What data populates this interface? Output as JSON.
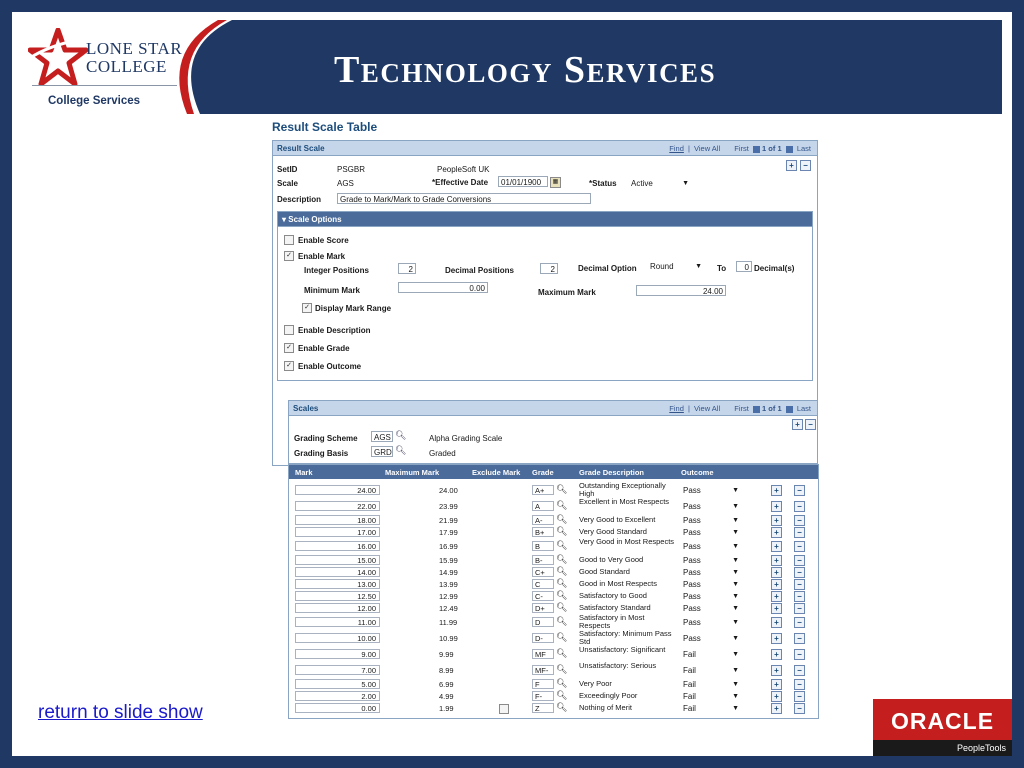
{
  "header": {
    "logo_line1": "Lone Star",
    "logo_line2": "College",
    "logo_services": "College Services",
    "title": "Technology Services",
    "brand_navy": "#1f3864",
    "brand_red": "#c41e1e"
  },
  "page_title": "Result Scale Table",
  "result_scale": {
    "bar_title": "Result Scale",
    "nav": {
      "find": "Find",
      "view_all": "View All",
      "first": "First",
      "count": "1 of 1",
      "last": "Last"
    },
    "setid_label": "SetID",
    "setid_value": "PSGBR",
    "setid_desc": "PeopleSoft UK",
    "scale_label": "Scale",
    "scale_value": "AGS",
    "eff_date_label": "*Effective Date",
    "eff_date_value": "01/01/1900",
    "status_label": "*Status",
    "status_value": "Active",
    "description_label": "Description",
    "description_value": "Grade to Mark/Mark to Grade Conversions"
  },
  "scale_options": {
    "bar_title": "Scale Options",
    "enable_score": "Enable Score",
    "enable_mark": "Enable Mark",
    "integer_positions_label": "Integer Positions",
    "integer_positions_value": "2",
    "decimal_positions_label": "Decimal Positions",
    "decimal_positions_value": "2",
    "decimal_option_label": "Decimal Option",
    "decimal_option_value": "Round",
    "to_label": "To",
    "to_value": "0",
    "decimals_label": "Decimal(s)",
    "minimum_mark_label": "Minimum Mark",
    "minimum_mark_value": "0.00",
    "maximum_mark_label": "Maximum Mark",
    "maximum_mark_value": "24.00",
    "display_mark_range": "Display Mark Range",
    "enable_description": "Enable Description",
    "enable_grade": "Enable Grade",
    "enable_outcome": "Enable Outcome"
  },
  "scales": {
    "bar_title": "Scales",
    "nav": {
      "find": "Find",
      "view_all": "View All",
      "first": "First",
      "count": "1 of 1",
      "last": "Last"
    },
    "grading_scheme_label": "Grading Scheme",
    "grading_scheme_value": "AGS",
    "grading_scheme_desc": "Alpha Grading Scale",
    "grading_basis_label": "Grading Basis",
    "grading_basis_value": "GRD",
    "grading_basis_desc": "Graded"
  },
  "grid": {
    "columns": [
      "Mark",
      "Maximum Mark",
      "Exclude Mark",
      "Grade",
      "Grade Description",
      "Outcome"
    ],
    "rows": [
      {
        "mark": "24.00",
        "max": "24.00",
        "grade": "A+",
        "desc": "Outstanding Exceptionally High",
        "outcome": "Pass"
      },
      {
        "mark": "22.00",
        "max": "23.99",
        "grade": "A",
        "desc": "Excellent in Most Respects",
        "outcome": "Pass"
      },
      {
        "mark": "18.00",
        "max": "21.99",
        "grade": "A-",
        "desc": "Very Good to Excellent",
        "outcome": "Pass"
      },
      {
        "mark": "17.00",
        "max": "17.99",
        "grade": "B+",
        "desc": "Very Good Standard",
        "outcome": "Pass"
      },
      {
        "mark": "16.00",
        "max": "16.99",
        "grade": "B",
        "desc": "Very Good in Most Respects",
        "outcome": "Pass"
      },
      {
        "mark": "15.00",
        "max": "15.99",
        "grade": "B-",
        "desc": "Good to Very Good",
        "outcome": "Pass"
      },
      {
        "mark": "14.00",
        "max": "14.99",
        "grade": "C+",
        "desc": "Good Standard",
        "outcome": "Pass"
      },
      {
        "mark": "13.00",
        "max": "13.99",
        "grade": "C",
        "desc": "Good in Most Respects",
        "outcome": "Pass"
      },
      {
        "mark": "12.50",
        "max": "12.99",
        "grade": "C-",
        "desc": "Satisfactory to Good",
        "outcome": "Pass"
      },
      {
        "mark": "12.00",
        "max": "12.49",
        "grade": "D+",
        "desc": "Satisfactory Standard",
        "outcome": "Pass"
      },
      {
        "mark": "11.00",
        "max": "11.99",
        "grade": "D",
        "desc": "Satisfactory in Most Respects",
        "outcome": "Pass"
      },
      {
        "mark": "10.00",
        "max": "10.99",
        "grade": "D-",
        "desc": "Satisfactory: Minimum Pass Std",
        "outcome": "Pass"
      },
      {
        "mark": "9.00",
        "max": "9.99",
        "grade": "MF",
        "desc": "Unsatisfactory: Significant",
        "outcome": "Fail"
      },
      {
        "mark": "7.00",
        "max": "8.99",
        "grade": "MF-",
        "desc": "Unsatisfactory: Serious",
        "outcome": "Fail"
      },
      {
        "mark": "5.00",
        "max": "6.99",
        "grade": "F",
        "desc": "Very Poor",
        "outcome": "Fail"
      },
      {
        "mark": "2.00",
        "max": "4.99",
        "grade": "F-",
        "desc": "Exceedingly Poor",
        "outcome": "Fail"
      },
      {
        "mark": "0.00",
        "max": "1.99",
        "grade": "Z",
        "desc": "Nothing of Merit",
        "outcome": "Fail"
      }
    ]
  },
  "footer": {
    "return_link": "return to slide show",
    "oracle_word": "ORACLE",
    "oracle_sub": "PeopleTools"
  }
}
